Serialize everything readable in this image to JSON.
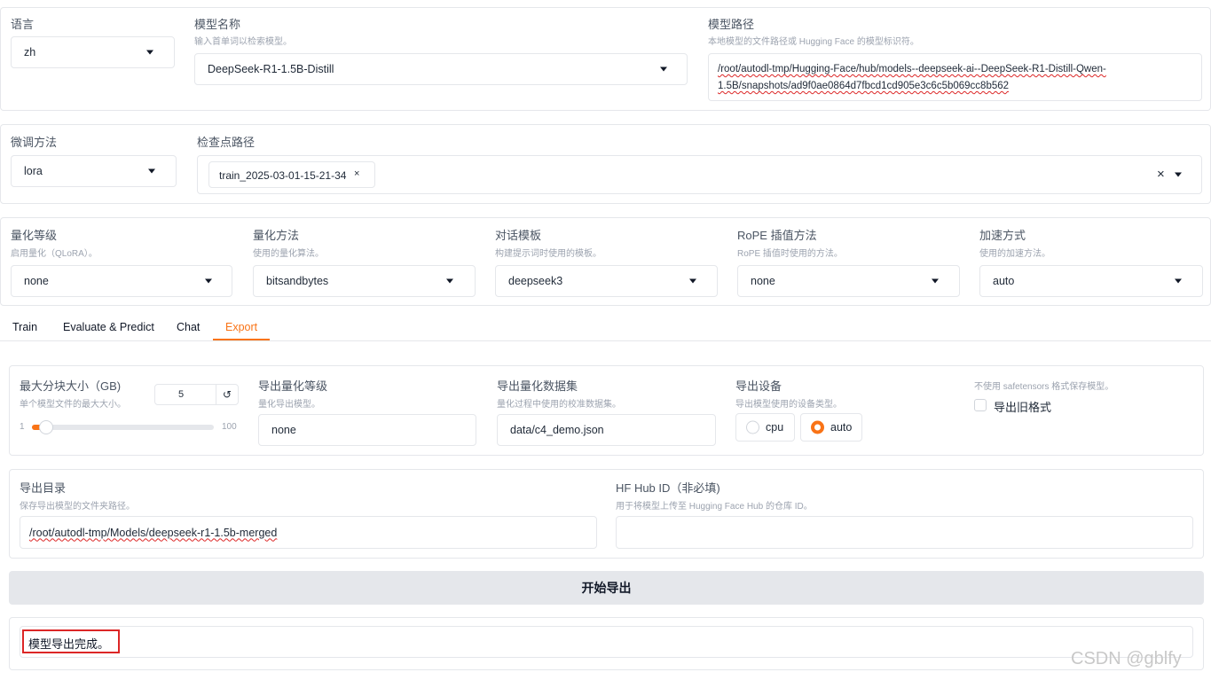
{
  "top": {
    "language": {
      "label": "语言",
      "value": "zh"
    },
    "model_name": {
      "label": "模型名称",
      "hint": "输入首单词以检索模型。",
      "value": "DeepSeek-R1-1.5B-Distill"
    },
    "model_path": {
      "label": "模型路径",
      "hint": "本地模型的文件路径或 Hugging Face 的模型标识符。",
      "line1": "/root/autodl-tmp/Hugging-Face/hub/models--deepseek-ai--DeepSeek-R1-Distill-Qwen-",
      "line2": "1.5B/snapshots/ad9f0ae0864d7fbcd1cd905e3c6c5b069cc8b562"
    }
  },
  "finetune": {
    "method": {
      "label": "微调方法",
      "value": "lora"
    },
    "checkpoint": {
      "label": "检查点路径",
      "chip": "train_2025-03-01-15-21-34",
      "chip_close": "×",
      "clear": "×"
    }
  },
  "advanced": {
    "quant_bit": {
      "label": "量化等级",
      "hint": "启用量化（QLoRA）。",
      "value": "none"
    },
    "quant_method": {
      "label": "量化方法",
      "hint": "使用的量化算法。",
      "value": "bitsandbytes"
    },
    "template": {
      "label": "对话模板",
      "hint": "构建提示词时使用的模板。",
      "value": "deepseek3"
    },
    "rope": {
      "label": "RoPE 插值方法",
      "hint": "RoPE 插值时使用的方法。",
      "value": "none"
    },
    "booster": {
      "label": "加速方式",
      "hint": "使用的加速方法。",
      "value": "auto"
    }
  },
  "tabs": [
    "Train",
    "Evaluate & Predict",
    "Chat",
    "Export"
  ],
  "active_tab": "Export",
  "export": {
    "shard": {
      "label": "最大分块大小（GB)",
      "hint": "单个模型文件的最大大小。",
      "value": "5",
      "reset": "↺",
      "min": "1",
      "max": "100",
      "fraction": 0.04
    },
    "quant_bit": {
      "label": "导出量化等级",
      "hint": "量化导出模型。",
      "value": "none"
    },
    "quant_dataset": {
      "label": "导出量化数据集",
      "hint": "量化过程中使用的校准数据集。",
      "value": "data/c4_demo.json"
    },
    "device": {
      "label": "导出设备",
      "hint": "导出模型使用的设备类型。",
      "options": [
        "cpu",
        "auto"
      ],
      "selected": "auto"
    },
    "legacy": {
      "hint": "不使用 safetensors 格式保存模型。",
      "label": "导出旧格式",
      "checked": false
    },
    "dir": {
      "label": "导出目录",
      "hint": "保存导出模型的文件夹路径。",
      "value": "/root/autodl-tmp/Models/deepseek-r1-1.5b-merged"
    },
    "hub": {
      "label": "HF Hub ID（非必填)",
      "hint": "用于将模型上传至 Hugging Face Hub 的仓库 ID。",
      "value": ""
    },
    "button": "开始导出",
    "output": "模型导出完成。"
  },
  "watermark": "CSDN @gblfy",
  "colors": {
    "accent": "#f97316",
    "highlight": "#dc2626"
  }
}
